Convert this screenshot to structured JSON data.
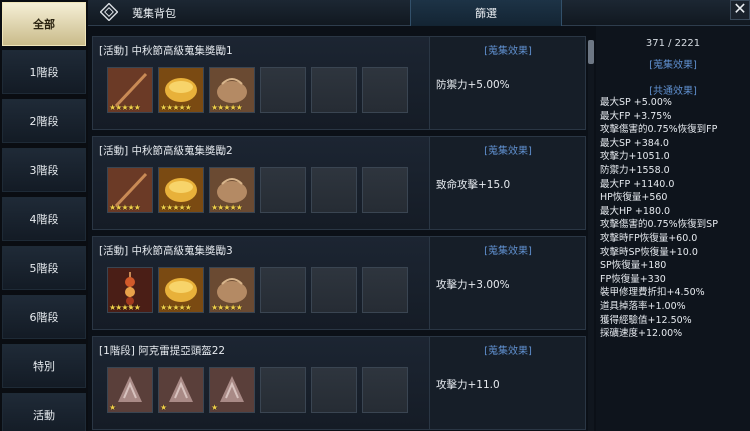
{
  "sidebar": {
    "categories": [
      "全部",
      "1階段",
      "2階段",
      "3階段",
      "4階段",
      "5階段",
      "6階段",
      "特別",
      "活動"
    ]
  },
  "header": {
    "title": "蒐集背包",
    "filter_tab": "篩選",
    "close_label": "✕"
  },
  "cards": [
    {
      "title": "[活動] 中秋節高級蒐集獎勵1",
      "effect_heading": "[蒐集效果]",
      "effect": "防禦力+5.00%",
      "items": [
        {
          "icon": "rod-icon",
          "stars": "★★★★★"
        },
        {
          "icon": "mooncake-icon",
          "stars": "★★★★★"
        },
        {
          "icon": "bag-icon",
          "stars": "★★★★★"
        }
      ]
    },
    {
      "title": "[活動] 中秋節高級蒐集獎勵2",
      "effect_heading": "[蒐集效果]",
      "effect": "致命攻擊+15.0",
      "items": [
        {
          "icon": "rod-icon",
          "stars": "★★★★★"
        },
        {
          "icon": "mooncake-icon",
          "stars": "★★★★★"
        },
        {
          "icon": "bag-icon",
          "stars": "★★★★★"
        }
      ]
    },
    {
      "title": "[活動] 中秋節高級蒐集獎勵3",
      "effect_heading": "[蒐集效果]",
      "effect": "攻擊力+3.00%",
      "items": [
        {
          "icon": "skewer-icon",
          "stars": "★★★★★"
        },
        {
          "icon": "mooncake-icon",
          "stars": "★★★★★"
        },
        {
          "icon": "bag-icon",
          "stars": "★★★★★"
        }
      ]
    },
    {
      "title": "[1階段] 阿克雷提亞頭盔22",
      "effect_heading": "[蒐集效果]",
      "effect": "攻擊力+11.0",
      "items": [
        {
          "icon": "helmet-icon",
          "stars": "★"
        },
        {
          "icon": "helmet-icon",
          "stars": "★"
        },
        {
          "icon": "helmet-icon",
          "stars": "★"
        }
      ]
    }
  ],
  "summary": {
    "count": "371 / 2221",
    "heading": "[蒐集效果]",
    "common_heading": "[共通效果]",
    "stats": [
      "最大SP +5.00%",
      "最大FP +3.75%",
      "攻擊傷害的0.75%恢復到FP",
      "最大SP +384.0",
      "攻擊力+1051.0",
      "防禦力+1558.0",
      "最大FP +1140.0",
      "HP恢復量+560",
      "最大HP +180.0",
      "攻擊傷害的0.75%恢復到SP",
      "攻擊時FP恢復量+60.0",
      "攻擊時SP恢復量+10.0",
      "SP恢復量+180",
      "FP恢復量+330",
      "裝甲修理費折扣+4.50%",
      "道具掉落率+1.00%",
      "獲得經驗值+12.50%",
      "採礦速度+12.00%"
    ]
  },
  "colors": {
    "accent_blue": "#5f8fce",
    "star_gold": "#f1d04a",
    "active_tab": "#efe4b8"
  }
}
